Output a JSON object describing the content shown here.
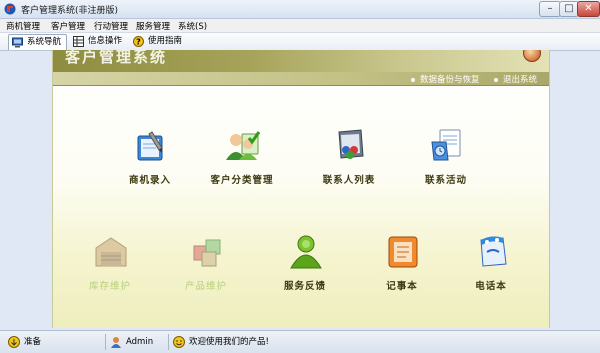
{
  "window": {
    "title": "客户管理系统(非注册版)",
    "controls": {
      "minimize": "–",
      "maximize": "□",
      "close": "✕"
    }
  },
  "menu": [
    "商机管理",
    "客户管理",
    "行动管理",
    "服务管理",
    "系统(S)"
  ],
  "tabs": [
    {
      "label": "系统导航",
      "icon": "monitor-icon",
      "active": true
    },
    {
      "label": "信息操作",
      "icon": "grid-icon",
      "active": false
    },
    {
      "label": "使用指南",
      "icon": "help-icon",
      "active": false
    }
  ],
  "banner": {
    "title": "客户管理系统",
    "links": [
      "数据备份与恢复",
      "退出系统"
    ]
  },
  "modules_row1": [
    {
      "label": "商机录入",
      "icon": "pen-document-icon",
      "faded": false
    },
    {
      "label": "客户分类管理",
      "icon": "users-check-icon",
      "faded": false
    },
    {
      "label": "联系人列表",
      "icon": "contact-list-icon",
      "faded": false
    },
    {
      "label": "联系活动",
      "icon": "activity-document-icon",
      "faded": false
    }
  ],
  "modules_row2": [
    {
      "label": "库存维护",
      "icon": "warehouse-icon",
      "faded": true
    },
    {
      "label": "产品维护",
      "icon": "product-box-icon",
      "faded": true
    },
    {
      "label": "服务反馈",
      "icon": "support-person-icon",
      "faded": false
    },
    {
      "label": "记事本",
      "icon": "notepad-icon",
      "faded": false
    },
    {
      "label": "电话本",
      "icon": "phonebook-icon",
      "faded": false
    }
  ],
  "status": {
    "state": "准备",
    "user": "Admin",
    "message": "欢迎使用我们的产品!"
  },
  "colors": {
    "accent_olive": "#8e8c3f",
    "caption_text": "#3d3a12",
    "faded_caption": "#b8cf7a"
  }
}
